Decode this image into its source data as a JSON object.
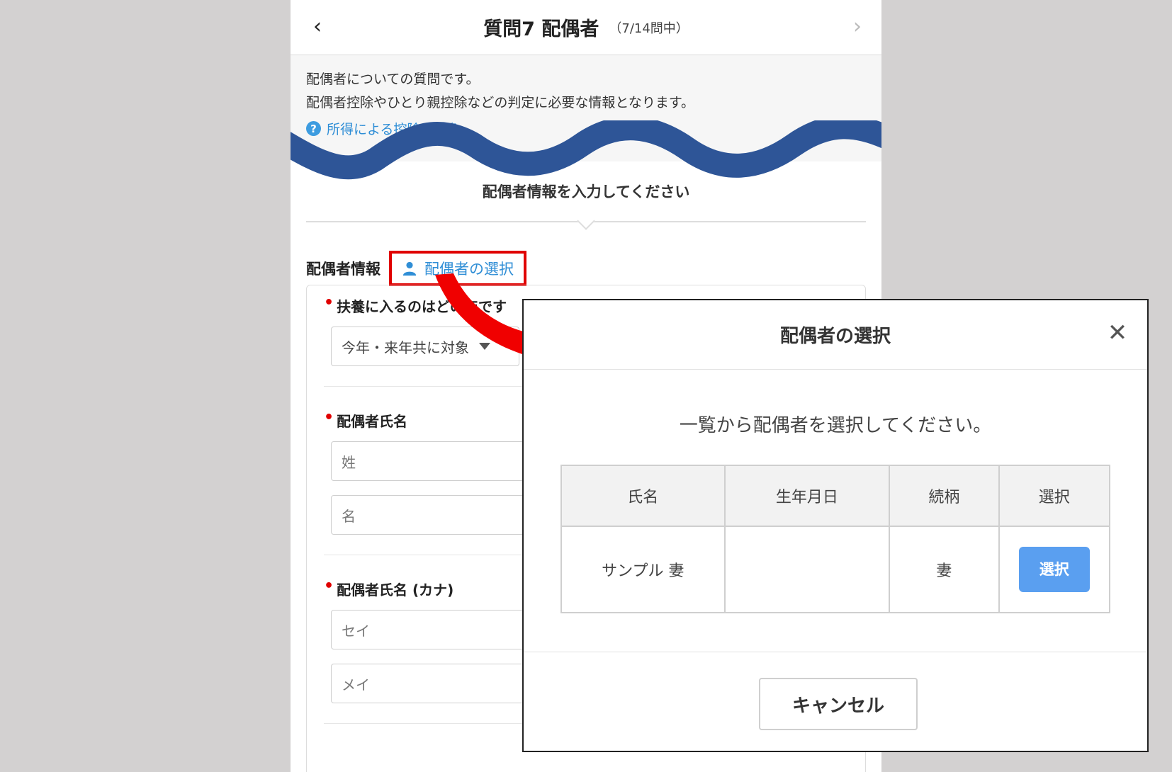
{
  "header": {
    "title": "質問7 配偶者",
    "subtitle": "（7/14問中）"
  },
  "intro": {
    "line1": "配偶者についての質問です。",
    "line2": "配偶者控除やひとり親控除などの判定に必要な情報となります。",
    "help_link": "所得による控除の対象"
  },
  "section": {
    "title": "配偶者情報を入力してください"
  },
  "spouse_info": {
    "label": "配偶者情報",
    "select_link": "配偶者の選択"
  },
  "form": {
    "q1_label": "扶養に入るのはどの年です",
    "q1_value": "今年・来年共に対象",
    "q2_label": "配偶者氏名",
    "last_name_placeholder": "姓",
    "first_name_placeholder": "名",
    "q3_label": "配偶者氏名 (カナ)",
    "last_kana_placeholder": "セイ",
    "first_kana_placeholder": "メイ"
  },
  "modal": {
    "title": "配偶者の選択",
    "message": "一覧から配偶者を選択してください。",
    "columns": [
      "氏名",
      "生年月日",
      "続柄",
      "選択"
    ],
    "rows": [
      {
        "name": "サンプル 妻",
        "birthdate": "",
        "relation": "妻",
        "action": "選択"
      }
    ],
    "cancel_label": "キャンセル"
  },
  "colors": {
    "accent_blue": "#2f8ed6",
    "highlight_red": "#e00000",
    "wave_navy": "#2e5597",
    "select_button": "#5a9ff0"
  }
}
